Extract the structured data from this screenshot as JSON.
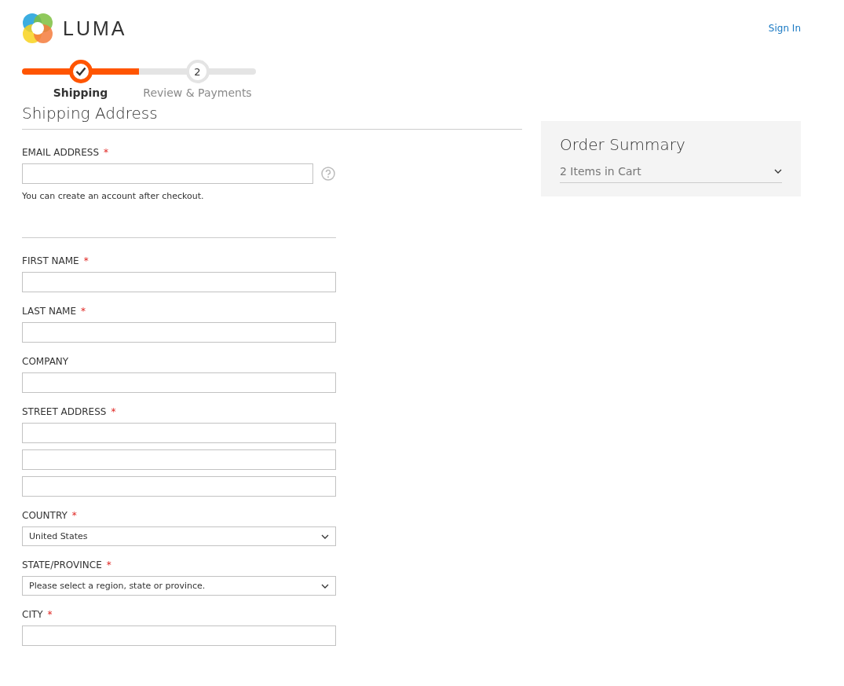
{
  "header": {
    "logo_text": "LUMA",
    "sign_in": "Sign In"
  },
  "steps": [
    {
      "label": "Shipping",
      "selected": true
    },
    {
      "label": "Review & Payments",
      "number": "2",
      "selected": false
    }
  ],
  "shipping": {
    "title": "Shipping Address",
    "email": {
      "label": "EMAIL ADDRESS",
      "required_mark": "*",
      "hint": "You can create an account after checkout."
    },
    "fields": [
      {
        "label": "FIRST NAME",
        "required_mark": "*",
        "kind": "text"
      },
      {
        "label": "LAST NAME",
        "required_mark": "*",
        "kind": "text"
      },
      {
        "label": "COMPANY",
        "kind": "text"
      },
      {
        "label": "STREET ADDRESS",
        "required_mark": "*",
        "kind": "street"
      },
      {
        "label": "COUNTRY",
        "required_mark": "*",
        "kind": "select",
        "value": "United States"
      },
      {
        "label": "STATE/PROVINCE",
        "required_mark": "*",
        "kind": "select",
        "value": "Please select a region, state or province."
      },
      {
        "label": "CITY",
        "required_mark": "*",
        "kind": "text"
      }
    ]
  },
  "summary": {
    "title": "Order Summary",
    "items": "2 Items in Cart",
    "expanded": false
  }
}
